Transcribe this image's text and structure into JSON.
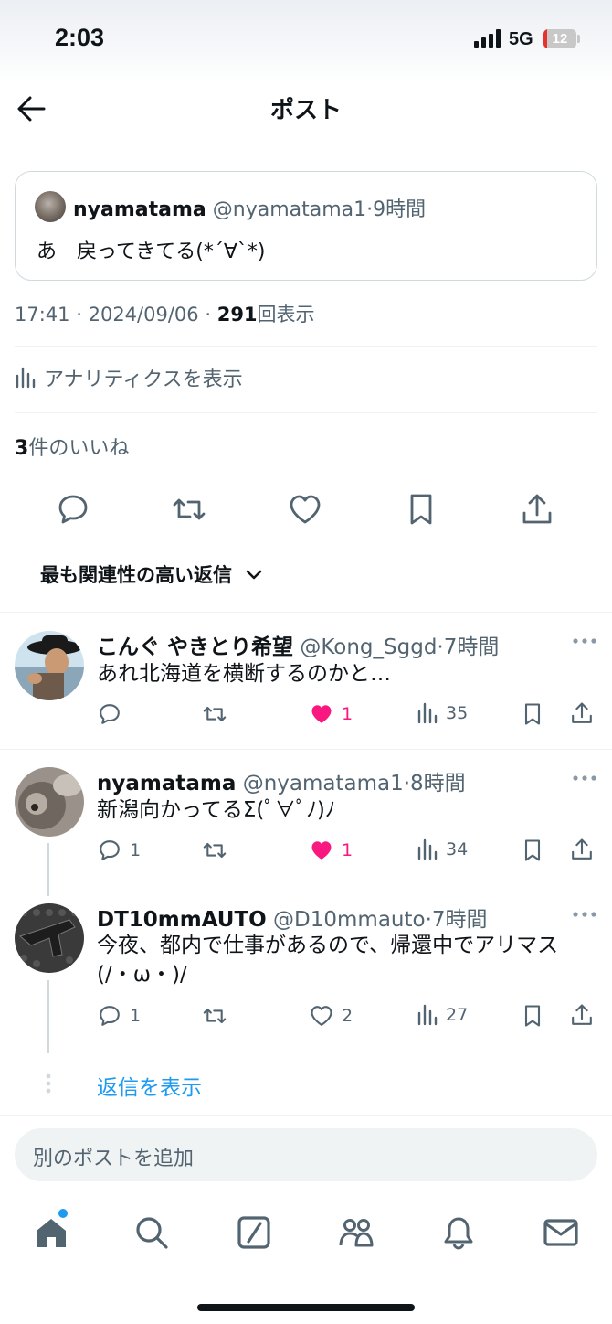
{
  "status_bar": {
    "time": "2:03",
    "network": "5G",
    "battery": "12",
    "battery_level": 0.12
  },
  "header": {
    "title": "ポスト"
  },
  "quoted_post": {
    "name": "nyamatama",
    "handle": "@nyamatama1",
    "age": "9時間",
    "text": "あ　戻ってきてる(*´∀`*)"
  },
  "post_meta": {
    "time": "17:41",
    "date": "2024/09/06",
    "views": "291",
    "views_label": "回表示"
  },
  "analytics_label": "アナリティクスを表示",
  "likes_summary": {
    "count": "3",
    "label": "件のいいね"
  },
  "actions": [
    "reply-icon",
    "repost-icon",
    "like-icon",
    "bookmark-icon",
    "share-icon"
  ],
  "sort_label": "最も関連性の高い返信",
  "replies": [
    {
      "name": "こんぐ やきとり希望",
      "handle": "@Kong_Sggd",
      "age": "7時間",
      "text": "あれ北海道を横断するのかと…",
      "replies": "",
      "likes": "1",
      "liked": true,
      "views": "35"
    },
    {
      "name": "nyamatama",
      "handle": "@nyamatama1",
      "age": "8時間",
      "text": "新潟向かってるΣ(ﾟ∀ﾟﾉ)ﾉ",
      "replies": "1",
      "likes": "1",
      "liked": true,
      "views": "34"
    },
    {
      "name": "DT10mmAUTO",
      "handle": "@D10mmauto",
      "age": "7時間",
      "text_line1": "今夜、都内で仕事があるので、帰還中でアリマス",
      "text_line2": "(/・ω・)/",
      "replies": "1",
      "likes": "2",
      "liked": false,
      "views": "27"
    }
  ],
  "show_replies_label": "返信を表示",
  "compose_placeholder": "別のポストを追加",
  "bottom_nav": [
    "home-icon",
    "search-icon",
    "grok-icon",
    "communities-icon",
    "notifications-icon",
    "messages-icon"
  ],
  "colors": {
    "accent": "#1d9bf0",
    "like": "#f91880",
    "text": "#0f1419",
    "muted": "#536471"
  }
}
